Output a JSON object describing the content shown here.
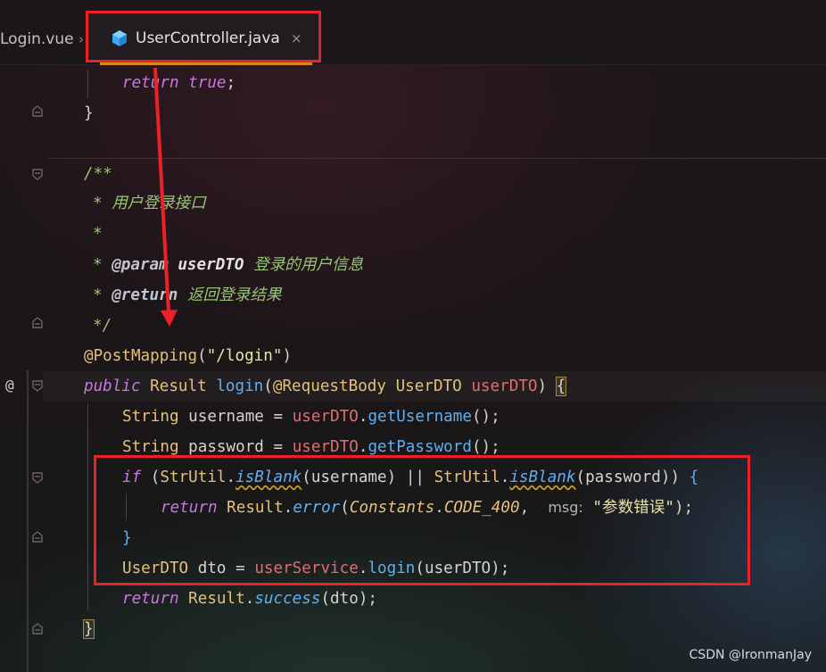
{
  "tabs": [
    {
      "label": "Login.vue",
      "close": "›",
      "active": false
    },
    {
      "label": "UserController.java",
      "close": "×",
      "active": true
    }
  ],
  "gutter": {
    "override_marker": "@"
  },
  "code": {
    "l1": {
      "kw": "return",
      "val": "true",
      "end": ";"
    },
    "l2": {
      "brace": "}"
    },
    "doc": {
      "open": "/**",
      "desc": "* 用户登录接口",
      "blank": "*",
      "param_star": "*",
      "param_tag": "@param",
      "param_name": "userDTO",
      "param_desc": "登录的用户信息",
      "return_star": "*",
      "return_tag": "@return",
      "return_desc": "返回登录结果",
      "close": "*/"
    },
    "mapping": {
      "ann": "@PostMapping",
      "open": "(",
      "path": "\"/login\"",
      "close": ")"
    },
    "sig": {
      "kw": "public",
      "ret": "Result",
      "name": "login",
      "open": "(",
      "ann": "@RequestBody",
      "ptype": "UserDTO",
      "pname": "userDTO",
      "close": ")",
      "brace": "{"
    },
    "l_user": {
      "type": "String",
      "var": "username",
      "eq": "=",
      "obj": "userDTO",
      "dot": ".",
      "call": "getUsername",
      "end": "();"
    },
    "l_pass": {
      "type": "String",
      "var": "password",
      "eq": "=",
      "obj": "userDTO",
      "dot": ".",
      "call": "getPassword",
      "end": "();"
    },
    "l_if": {
      "kw": "if",
      "open": "(",
      "cls1": "StrUtil",
      "dot1": ".",
      "m1": "isBlank",
      "a1": "(username)",
      "or": "||",
      "cls2": "StrUtil",
      "dot2": ".",
      "m2": "isBlank",
      "a2": "(password)",
      "close": ")",
      "brace": "{"
    },
    "l_err": {
      "kw": "return",
      "cls": "Result",
      "dot": ".",
      "m": "error",
      "open": "(",
      "c1": "Constants",
      "dot2": ".",
      "c2": "CODE_400",
      "comma": ",",
      "hint": "msg:",
      "str": "\"参数错误\"",
      "end": ");"
    },
    "l_endif": {
      "brace": "}"
    },
    "l_dto": {
      "type": "UserDTO",
      "var": "dto",
      "eq": "=",
      "obj": "userService",
      "dot": ".",
      "call": "login",
      "arg": "(userDTO);"
    },
    "l_ret": {
      "kw": "return",
      "cls": "Result",
      "dot": ".",
      "m": "success",
      "arg": "(dto);"
    },
    "l_end": {
      "brace": "}"
    }
  },
  "watermark": "CSDN @IronmanJay",
  "colors": {
    "annotation_red": "#ec2127",
    "tab_underline": "#d18a20"
  }
}
